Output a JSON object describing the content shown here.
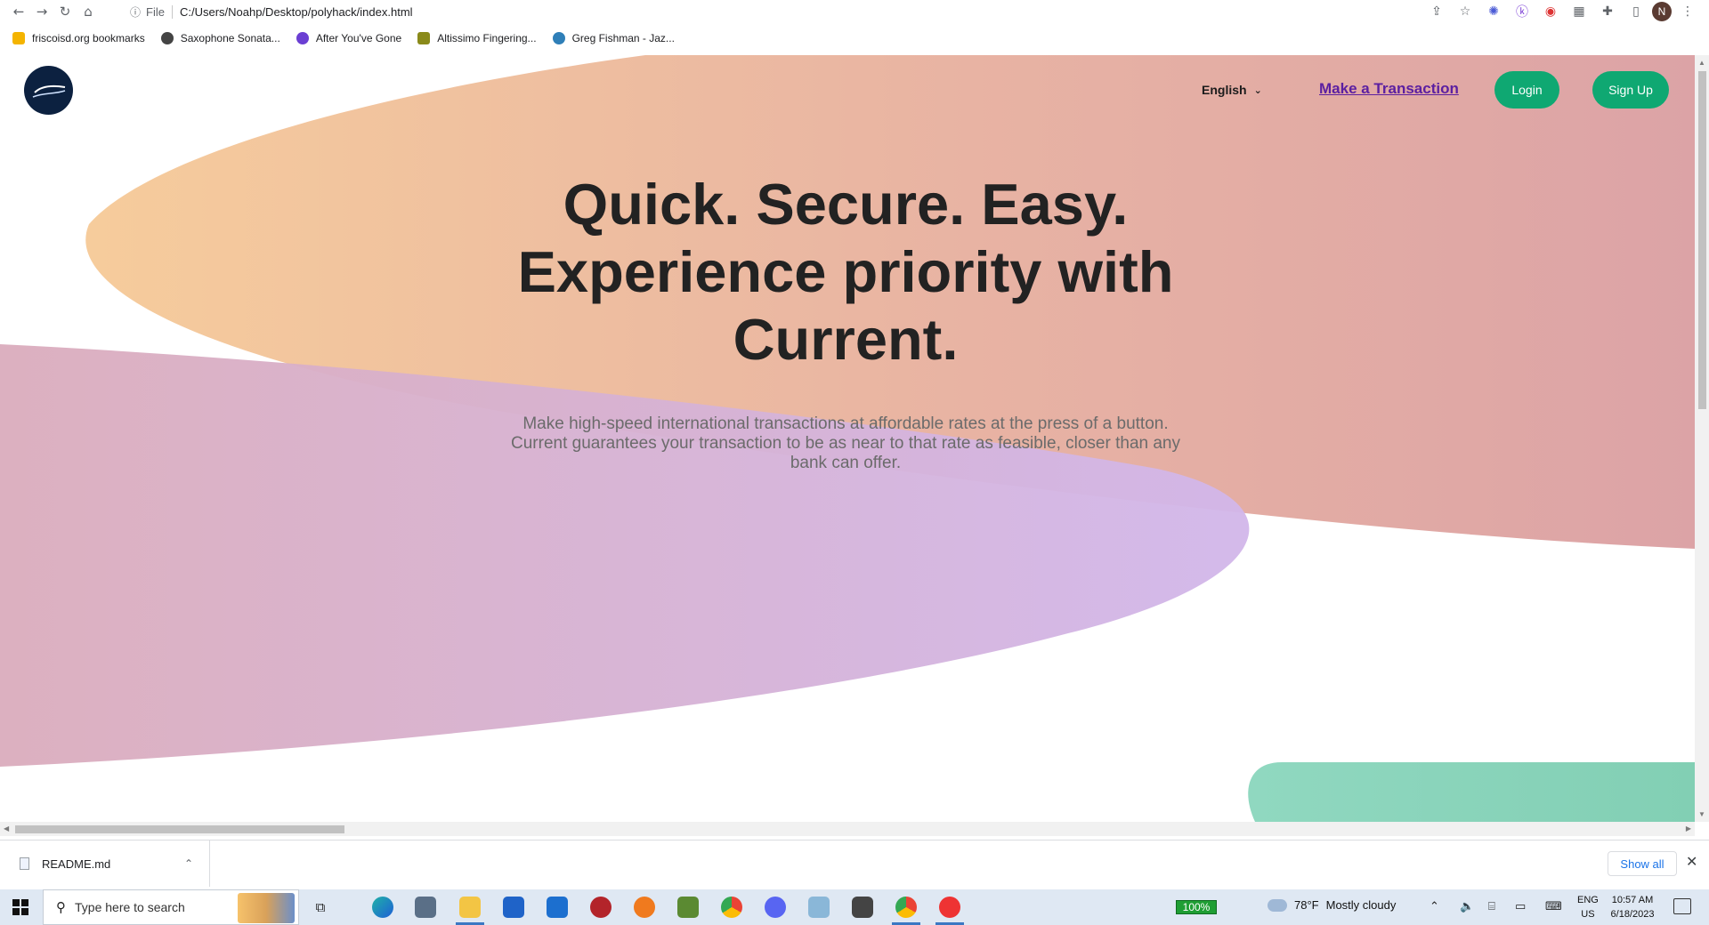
{
  "browser": {
    "url_scheme": "File",
    "url": "C:/Users/Noahp/Desktop/polyhack/index.html",
    "profile_initial": "N"
  },
  "bookmarks": [
    {
      "label": "friscoisd.org bookmarks",
      "color": "#f4b400"
    },
    {
      "label": "Saxophone Sonata...",
      "color": "#444444"
    },
    {
      "label": "After You've Gone",
      "color": "#6b3fd3"
    },
    {
      "label": "Altissimo Fingering...",
      "color": "#8a8a1a"
    },
    {
      "label": "Greg Fishman - Jaz...",
      "color": "#2f7fb8"
    }
  ],
  "page": {
    "nav": {
      "language": "English",
      "make_transaction": "Make a Transaction",
      "login": "Login",
      "signup": "Sign Up"
    },
    "hero": {
      "line1": "Quick. Secure. Easy.",
      "line2": "Experience priority with",
      "line3": "Current.",
      "subtitle": "Make high-speed international transactions at affordable rates at the press of a button. Current guarantees your transaction to be as near to that rate as feasible, closer than any bank can offer."
    },
    "colors": {
      "peach": "#f6c99c",
      "rose": "#dba4a6",
      "lavender": "#d3b6e9",
      "mauve": "#d8aec6",
      "teal": "#88d3b8",
      "brand_green": "#0fa872",
      "link_purple": "#5b1fa1"
    }
  },
  "downloads": {
    "file": "README.md",
    "show_all": "Show all"
  },
  "taskbar": {
    "search_placeholder": "Type here to search",
    "battery": "100%",
    "weather_temp": "78°F",
    "weather_desc": "Mostly cloudy",
    "lang_line1": "ENG",
    "lang_line2": "US",
    "time": "10:57 AM",
    "date": "6/18/2023"
  }
}
